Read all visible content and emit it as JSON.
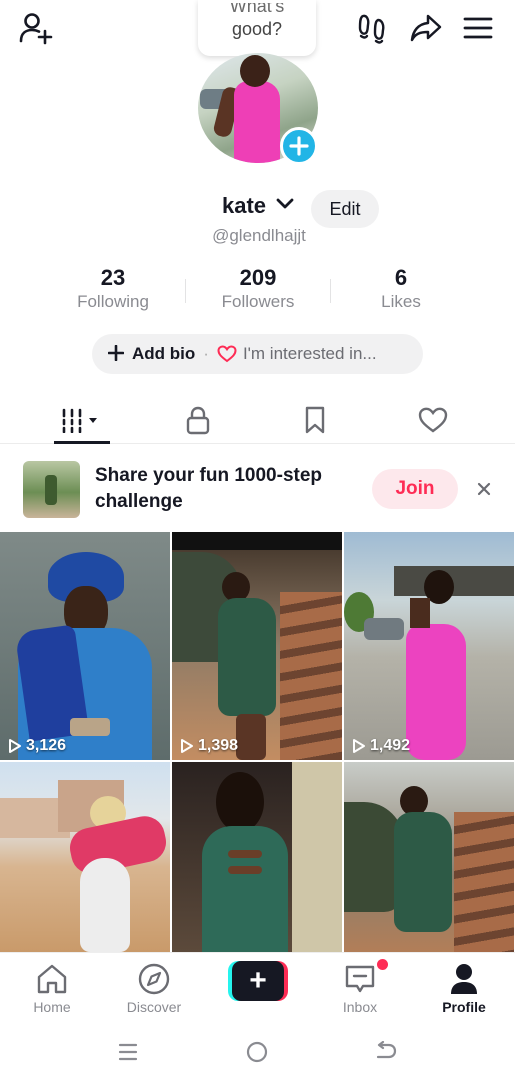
{
  "bubble": {
    "line1": "What's",
    "line2": "good?"
  },
  "profile": {
    "username": "kate",
    "handle": "@glendlhajjt",
    "edit_label": "Edit",
    "stats": [
      {
        "value": "23",
        "label": "Following"
      },
      {
        "value": "209",
        "label": "Followers"
      },
      {
        "value": "6",
        "label": "Likes"
      }
    ],
    "bio": {
      "add_label": "Add bio",
      "separator": "·",
      "interest_label": "I'm interested in..."
    }
  },
  "challenge": {
    "text": "Share your fun 1000-step challenge",
    "join_label": "Join"
  },
  "videos": [
    {
      "views": "3,126"
    },
    {
      "views": "1,398"
    },
    {
      "views": "1,492"
    }
  ],
  "nav": {
    "items": [
      {
        "label": "Home"
      },
      {
        "label": "Discover"
      },
      {
        "label": "Inbox"
      },
      {
        "label": "Profile"
      }
    ],
    "create_symbol": "+"
  },
  "colors": {
    "accent": "#fe2c55",
    "cyan": "#25f4ee",
    "badge_blue": "#22b5e6",
    "text": "#161823",
    "muted": "#8a8b91"
  },
  "icons": [
    "add-user-icon",
    "footprints-icon",
    "share-icon",
    "menu-icon",
    "chevron-down-icon",
    "grid-icon",
    "lock-icon",
    "bookmark-icon",
    "heart-icon",
    "close-icon",
    "play-icon",
    "home-icon",
    "compass-icon",
    "inbox-icon",
    "profile-icon",
    "recents-icon",
    "home-circle-icon",
    "back-icon"
  ]
}
